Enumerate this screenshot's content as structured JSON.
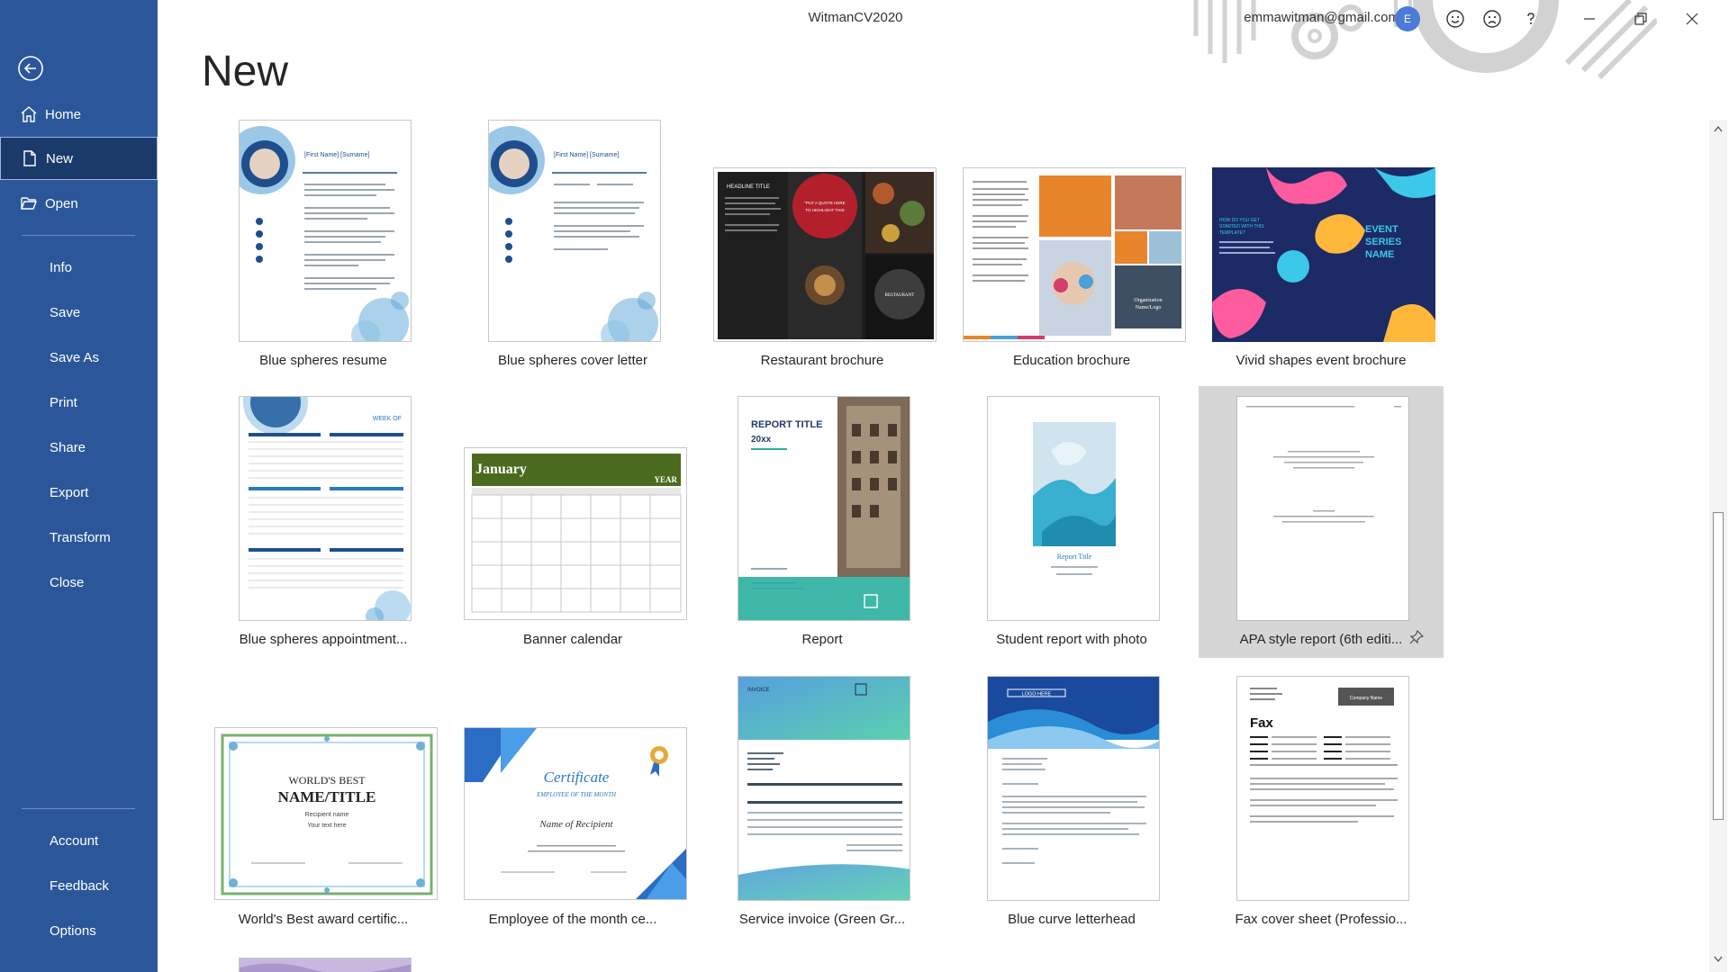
{
  "window": {
    "doc_title": "WitmanCV2020",
    "user_email": "emmawitman@gmail.com",
    "avatar_initial": "E"
  },
  "sidebar": {
    "items": [
      {
        "label": "Home",
        "icon": "home-icon"
      },
      {
        "label": "New",
        "icon": "new-document-icon"
      },
      {
        "label": "Open",
        "icon": "folder-open-icon"
      },
      {
        "label": "Info"
      },
      {
        "label": "Save"
      },
      {
        "label": "Save As"
      },
      {
        "label": "Print"
      },
      {
        "label": "Share"
      },
      {
        "label": "Export"
      },
      {
        "label": "Transform"
      },
      {
        "label": "Close"
      },
      {
        "label": "Account"
      },
      {
        "label": "Feedback"
      },
      {
        "label": "Options"
      }
    ],
    "selected": "New"
  },
  "main": {
    "title": "New",
    "templates": [
      {
        "label": "Blue spheres resume"
      },
      {
        "label": "Blue spheres cover letter"
      },
      {
        "label": "Restaurant brochure"
      },
      {
        "label": "Education brochure"
      },
      {
        "label": "Vivid shapes event brochure"
      },
      {
        "label": "Blue spheres appointment..."
      },
      {
        "label": "Banner calendar"
      },
      {
        "label": "Report"
      },
      {
        "label": "Student report with photo"
      },
      {
        "label": "APA style report (6th editi..."
      },
      {
        "label": "World's Best award certific..."
      },
      {
        "label": "Employee of the month ce..."
      },
      {
        "label": "Service invoice (Green Gr..."
      },
      {
        "label": "Blue curve letterhead"
      },
      {
        "label": "Fax cover sheet (Professio..."
      }
    ],
    "selected_template": "APA style report (6th editi..."
  },
  "thumb_text": {
    "resume_name": "[First Name] [Surname]",
    "restaurant_headline": "HEADLINE TITLE",
    "restaurant_quote": "\"PUT A QUOTE HERE TO HIGHLIGHT THIS ISSUE OF YOUR NEWSLETTER.\"",
    "restaurant_word": "RESTAURANT",
    "education_org": "Organization Name/Logo",
    "vivid_title": "EVENT SERIES NAME",
    "vivid_question": "HOW DO YOU GET STARTED WITH THIS TEMPLATE?",
    "appointment_week": "WEEK OF",
    "calendar_month": "January",
    "calendar_year": "YEAR",
    "report_title": "REPORT TITLE",
    "report_year": "20xx",
    "student_title": "Report Title",
    "award_line1": "WORLD'S BEST",
    "award_line2": "NAME/TITLE",
    "award_line3": "Recipient name",
    "award_line4": "Your text here",
    "cert_title": "Certificate",
    "cert_sub": "EMPLOYEE OF THE MONTH",
    "cert_name": "Name of Recipient",
    "invoice_word": "INVOICE",
    "letterhead_logo": "LOGO HERE",
    "fax_word": "Fax",
    "fax_company": "Company Name"
  },
  "colors": {
    "sidebar_bg": "#2b579a",
    "sidebar_selected": "#1a3a6b",
    "selected_tile": "#d6d6d6",
    "avatar": "#4b7bd6"
  }
}
